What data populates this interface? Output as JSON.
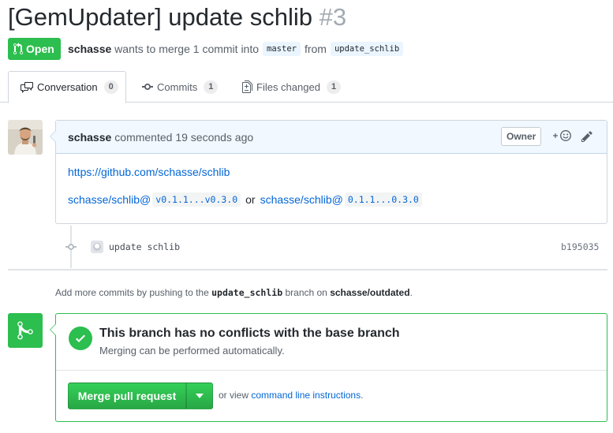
{
  "pr": {
    "title": "[GemUpdater] update schlib",
    "number": "#3",
    "state": "Open",
    "author": "schasse",
    "merge_text": "wants to merge 1 commit into",
    "base_branch": "master",
    "from_text": "from",
    "head_branch": "update_schlib"
  },
  "tabs": [
    {
      "label": "Conversation",
      "count": "0"
    },
    {
      "label": "Commits",
      "count": "1"
    },
    {
      "label": "Files changed",
      "count": "1"
    }
  ],
  "comment": {
    "author": "schasse",
    "action": "commented 19 seconds ago",
    "badge": "Owner",
    "link": "https://github.com/schasse/schlib",
    "ref1_label": "schasse/schlib@",
    "ref1_code": "v0.1.1...v0.3.0",
    "or_text": "or",
    "ref2_label": "schasse/schlib@",
    "ref2_code": "0.1.1...0.3.0"
  },
  "commit": {
    "message": "update schlib",
    "sha": "b195035"
  },
  "hint": {
    "prefix": "Add more commits by pushing to the",
    "branch": "update_schlib",
    "middle": "branch on",
    "repo": "schasse/outdated",
    "suffix": "."
  },
  "merge": {
    "title": "This branch has no conflicts with the base branch",
    "subtitle": "Merging can be performed automatically.",
    "button": "Merge pull request",
    "alt_prefix": "or view",
    "alt_link": "command line instructions",
    "alt_suffix": "."
  },
  "colors": {
    "green": "#2cbe4e",
    "link": "#0366d6",
    "muted": "#586069"
  }
}
